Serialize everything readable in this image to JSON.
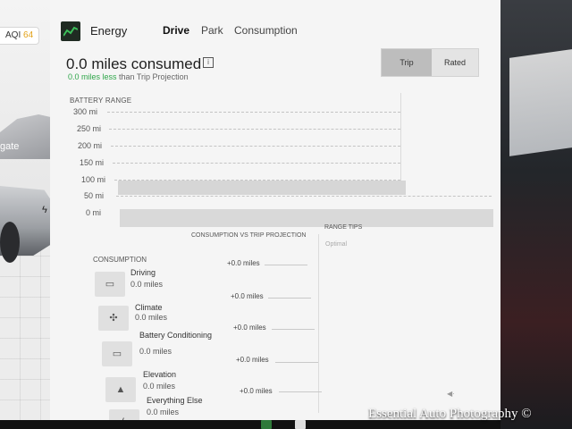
{
  "status": {
    "aqi_label": "AQI",
    "aqi_value": "64"
  },
  "car_view": {
    "partial_text": "gate"
  },
  "header": {
    "app_title": "Energy",
    "tabs": [
      {
        "label": "Drive"
      },
      {
        "label": "Park"
      },
      {
        "label": "Consumption"
      }
    ]
  },
  "summary": {
    "miles_consumed": "0.0 miles consumed",
    "info_glyph": "i",
    "delta_value": "0.0 miles less",
    "delta_suffix": " than Trip Projection"
  },
  "segmented": {
    "options": [
      {
        "label": "Trip"
      },
      {
        "label": "Rated"
      }
    ],
    "selected": "Trip"
  },
  "range_chart": {
    "title": "BATTERY RANGE",
    "ticks": [
      "300 mi",
      "250 mi",
      "200 mi",
      "150 mi",
      "100 mi",
      "50 mi",
      "0 mi"
    ]
  },
  "consumption": {
    "title": "CONSUMPTION",
    "vs_title": "CONSUMPTION VS TRIP PROJECTION",
    "items": [
      {
        "name": "Driving",
        "value": "0.0 miles",
        "delta": "+0.0 miles",
        "icon": "car-icon"
      },
      {
        "name": "Climate",
        "value": "0.0 miles",
        "delta": "+0.0 miles",
        "icon": "fan-icon"
      },
      {
        "name": "Battery Conditioning",
        "value": "0.0 miles",
        "delta": "+0.0 miles",
        "icon": "battery-icon"
      },
      {
        "name": "Elevation",
        "value": "0.0 miles",
        "delta": "+0.0 miles",
        "icon": "mountain-icon"
      },
      {
        "name": "Everything Else",
        "value": "0.0 miles",
        "delta": "+0.0 miles",
        "icon": "bolt-icon"
      }
    ]
  },
  "range_tips": {
    "title": "RANGE TIPS",
    "value": "Optimal"
  },
  "watermark": "Essential Auto Photography ©",
  "colors": {
    "accent_green": "#2fa64a",
    "aqi_orange": "#e3a21a"
  }
}
